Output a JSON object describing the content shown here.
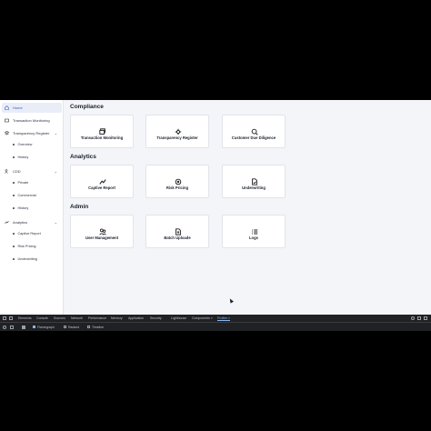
{
  "sidebar": {
    "home": "Home",
    "transaction_monitoring": "Transaction Monitoring",
    "transparency_register": {
      "label": "Transparency Register",
      "children": [
        "Overview",
        "History"
      ]
    },
    "cdd": {
      "label": "CDD",
      "children": [
        "Private",
        "Commercial",
        "History"
      ]
    },
    "analytics": {
      "label": "Analytics",
      "children": [
        "Captive Report",
        "Risk Pricing",
        "Underwriting"
      ]
    }
  },
  "sections": {
    "compliance": {
      "title": "Compliance",
      "cards": [
        "Transaction Monitoring",
        "Transparency Register",
        "Customer Due Diligence"
      ]
    },
    "analytics": {
      "title": "Analytics",
      "cards": [
        "Captive Report",
        "Risk Pricing",
        "Underwriting"
      ]
    },
    "admin": {
      "title": "Admin",
      "cards": [
        "User Management",
        "Batch Uploade",
        "Logs"
      ]
    }
  },
  "devtools": {
    "tabs": [
      "Elements",
      "Console",
      "Sources",
      "Network",
      "Performance",
      "Memory",
      "Application",
      "Security",
      "Lighthouse",
      "Components »",
      "Profiler »"
    ],
    "active_tab": "Profiler »",
    "tools": [
      "Flamegraph",
      "Ranked",
      "Timeline"
    ]
  },
  "colors": {
    "accent": "#3a5ccc",
    "background": "#f4f5f8",
    "devtools_bg": "#202124"
  },
  "icons": {
    "home": "home-icon",
    "transaction_monitoring": "card-icon",
    "transparency_register": "layers-icon",
    "cdd": "people-icon",
    "analytics": "chart-icon"
  }
}
